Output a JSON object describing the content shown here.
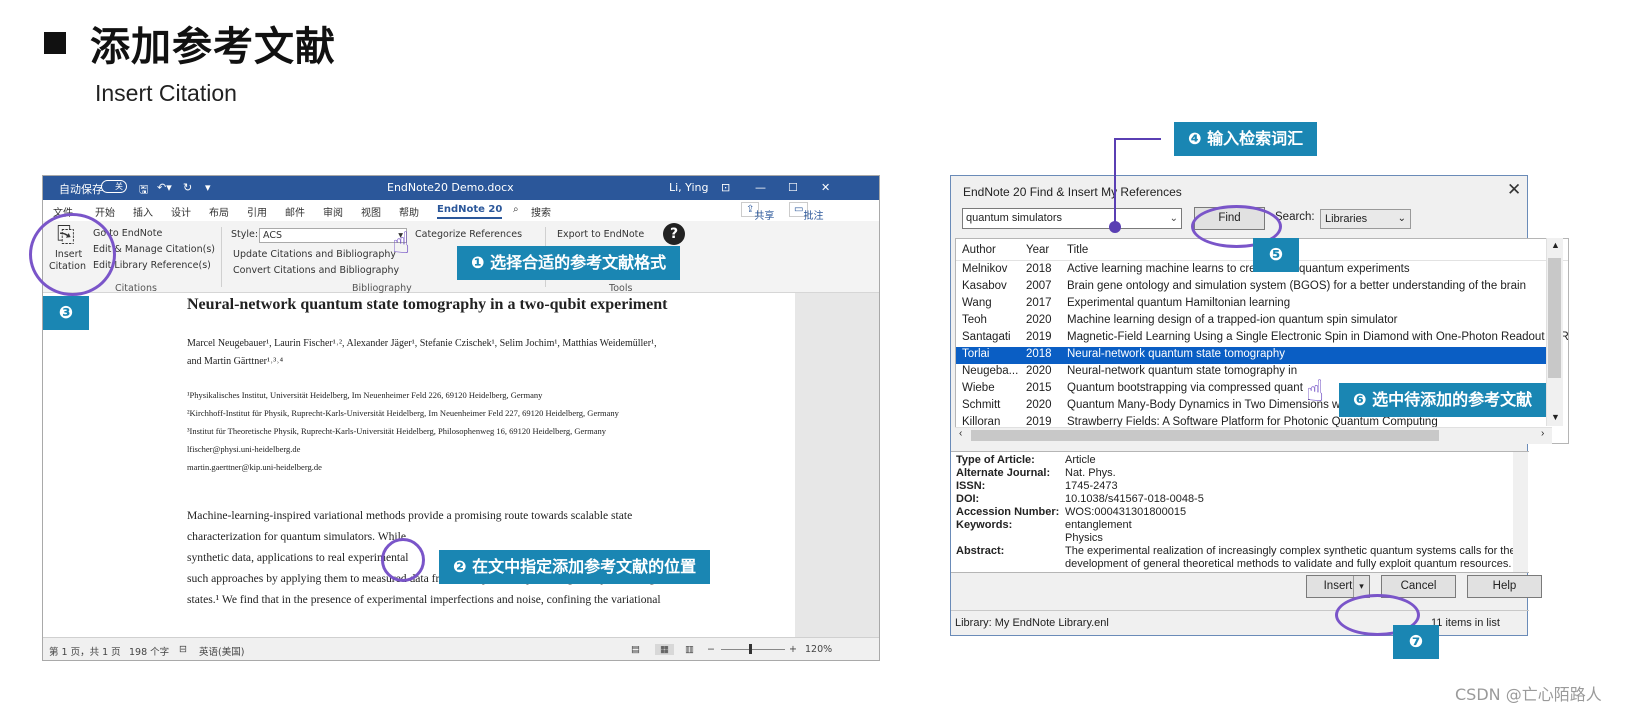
{
  "slide": {
    "title": "添加参考文献",
    "subtitle": "Insert Citation",
    "watermark": "CSDN @亡心陌路人"
  },
  "word": {
    "title_bar": {
      "autosave": "自动保存",
      "autosave_state": "关",
      "doc_name": "EndNote20 Demo.docx",
      "user": "Li, Ying"
    },
    "tabs": [
      "文件",
      "开始",
      "插入",
      "设计",
      "布局",
      "引用",
      "邮件",
      "审阅",
      "视图",
      "帮助",
      "EndNote 20",
      "搜索"
    ],
    "share_label": "共享",
    "comments_label": "批注",
    "ribbon": {
      "insert_citation": "Insert",
      "insert_citation_2": "Citation",
      "go_to_endnote": "Go to EndNote",
      "edit_manage": "Edit & Manage Citation(s)",
      "edit_library": "Edit Library Reference(s)",
      "citations_group": "Citations",
      "style_label": "Style:",
      "style_value": "ACS",
      "update_citations": "Update Citations and Bibliography",
      "convert_citations": "Convert Citations and Bibliography",
      "categorize": "Categorize References",
      "bibliography_group": "Bibliography",
      "export": "Export to EndNote",
      "tools_group": "Tools"
    },
    "document": {
      "title": "Neural-network quantum state tomography in a two-qubit experiment",
      "authors_1": "Marcel Neugebauer¹, Laurin Fischer¹˒², Alexander Jäger¹, Stefanie Czischek¹, Selim Jochim¹, Matthias Weidemüller¹,",
      "authors_2": "and Martin Gärttner¹˒³˒⁴",
      "affil": [
        "¹Physikalisches Institut, Universität Heidelberg, Im Neuenheimer Feld 226, 69120 Heidelberg, Germany",
        "²Kirchhoff-Institut für Physik, Ruprecht-Karls-Universität Heidelberg, Im Neuenheimer Feld 227, 69120 Heidelberg, Germany",
        "³Institut für Theoretische Physik, Ruprecht-Karls-Universität Heidelberg, Philosophenweg 16, 69120 Heidelberg, Germany",
        "lfischer@physi.uni-heidelberg.de",
        "martin.gaerttner@kip.uni-heidelberg.de"
      ],
      "body": [
        "Machine-learning-inspired  variational  methods  provide  a  promising  route  towards  scalable  state",
        "characterization for quantum simulators. While",
        "synthetic data, applications to real experimental",
        "such approaches by applying them to measured data from an experiment producing two-qubit entangled",
        "states.¹ We find that in the presence of experimental imperfections and noise, confining the variational"
      ]
    },
    "status": {
      "page": "第 1 页，共 1 页",
      "words": "198 个字",
      "language": "英语(美国)",
      "zoom": "120%"
    }
  },
  "endnote": {
    "title": "EndNote 20 Find & Insert My References",
    "search_value": "quantum simulators",
    "find_label": "Find",
    "search_label": "Search:",
    "search_in": "Libraries",
    "columns": [
      "Author",
      "Year",
      "Title"
    ],
    "rows": [
      {
        "author": "Melnikov",
        "year": "2018",
        "title": "Active learning machine learns to create new quantum experiments"
      },
      {
        "author": "Kasabov",
        "year": "2007",
        "title": "Brain gene ontology and simulation system (BGOS) for a better understanding of the brain"
      },
      {
        "author": "Wang",
        "year": "2017",
        "title": "Experimental quantum Hamiltonian learning"
      },
      {
        "author": "Teoh",
        "year": "2020",
        "title": "Machine learning design of a trapped-ion quantum spin simulator"
      },
      {
        "author": "Santagati",
        "year": "2019",
        "title": "Magnetic-Field Learning Using a Single Electronic Spin in Diamond with One-Photon Readout at Room"
      },
      {
        "author": "Torlai",
        "year": "2018",
        "title": "Neural-network quantum state tomography"
      },
      {
        "author": "Neugeba...",
        "year": "2020",
        "title": "Neural-network quantum state tomography in"
      },
      {
        "author": "Wiebe",
        "year": "2015",
        "title": "Quantum bootstrapping via compressed quant"
      },
      {
        "author": "Schmitt",
        "year": "2020",
        "title": "Quantum Many-Body Dynamics in Two Dimensions with Artificial Neural Networks"
      },
      {
        "author": "Killoran",
        "year": "2019",
        "title": "Strawberry Fields: A Software Platform for Photonic Quantum Computing"
      }
    ],
    "details": [
      {
        "label": "Type of Article:",
        "value": "Article"
      },
      {
        "label": "Alternate Journal:",
        "value": "Nat. Phys."
      },
      {
        "label": "ISSN:",
        "value": "1745-2473"
      },
      {
        "label": "DOI:",
        "value": "10.1038/s41567-018-0048-5"
      },
      {
        "label": "Accession Number:",
        "value": "WOS:000431301800015"
      },
      {
        "label": "Keywords:",
        "value": "entanglement"
      },
      {
        "label": "",
        "value": "Physics"
      },
      {
        "label": "Abstract:",
        "value": "The experimental realization of increasingly complex synthetic quantum systems calls for the"
      },
      {
        "label": "",
        "value": "development of general theoretical methods to validate and fully exploit quantum resources."
      }
    ],
    "insert_label": "Insert",
    "cancel_label": "Cancel",
    "help_label": "Help",
    "library_status": "Library: My EndNote Library.enl",
    "items_status": "11 items in list"
  },
  "annotations": {
    "a1": "❶ 选择合适的参考文献格式",
    "a2": "❷ 在文中指定添加参考文献的位置",
    "n3": "❸",
    "a4": "❹ 输入检索词汇",
    "n5": "❺",
    "a6": "❻ 选中待添加的参考文献",
    "n7": "❼"
  },
  "colors": {
    "word_titlebar": "#2b579a",
    "annotation_bg": "#1a86b3",
    "highlight_oval": "#7a55c9",
    "selected_row": "#0a5ec4"
  }
}
